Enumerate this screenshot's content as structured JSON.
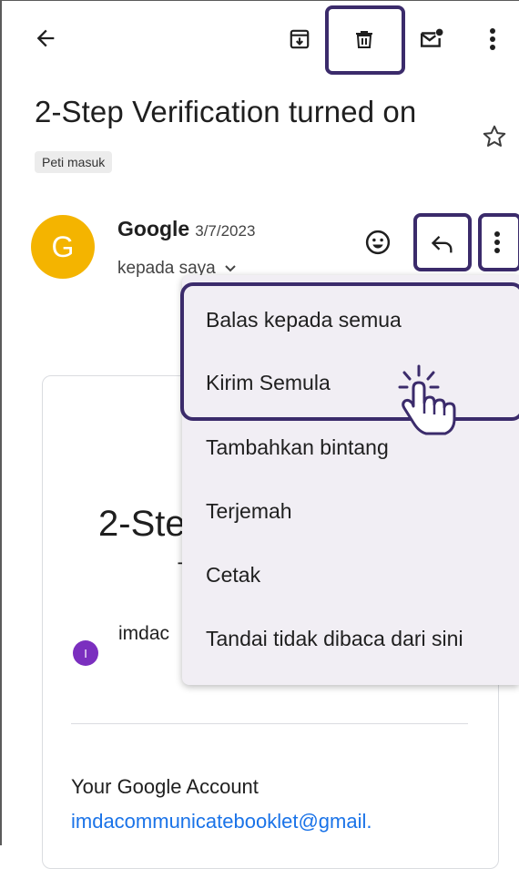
{
  "toolbar": {
    "icons": [
      "back-arrow-icon",
      "archive-icon",
      "delete-icon",
      "mark-unread-icon",
      "more-vert-icon"
    ]
  },
  "email": {
    "subject": "2-Step Verification turned on",
    "label": "Peti masuk",
    "sender": "Google",
    "avatar_letter": "G",
    "date": "3/7/2023",
    "recipient": "kepada saya"
  },
  "menu": {
    "items": [
      "Balas kepada semua",
      "Kirim Semula",
      "Tambahkan bintang",
      "Terjemah",
      "Cetak",
      "Tandai tidak dibaca dari sini"
    ],
    "highlighted_item": "Kirim Semula"
  },
  "body": {
    "title_fragment": "2-Ste",
    "subtitle_fragment": "T",
    "account_initial": "I",
    "account_fragment": "imdac",
    "your_account": "Your Google Account",
    "account_link": "imdacommunicatebooklet@gmail."
  },
  "colors": {
    "avatar": "#f4b400",
    "account_avatar": "#7b2fbf",
    "link": "#1a73e8",
    "highlight": "#3b2b6b",
    "menu_bg": "#f1eef4"
  }
}
